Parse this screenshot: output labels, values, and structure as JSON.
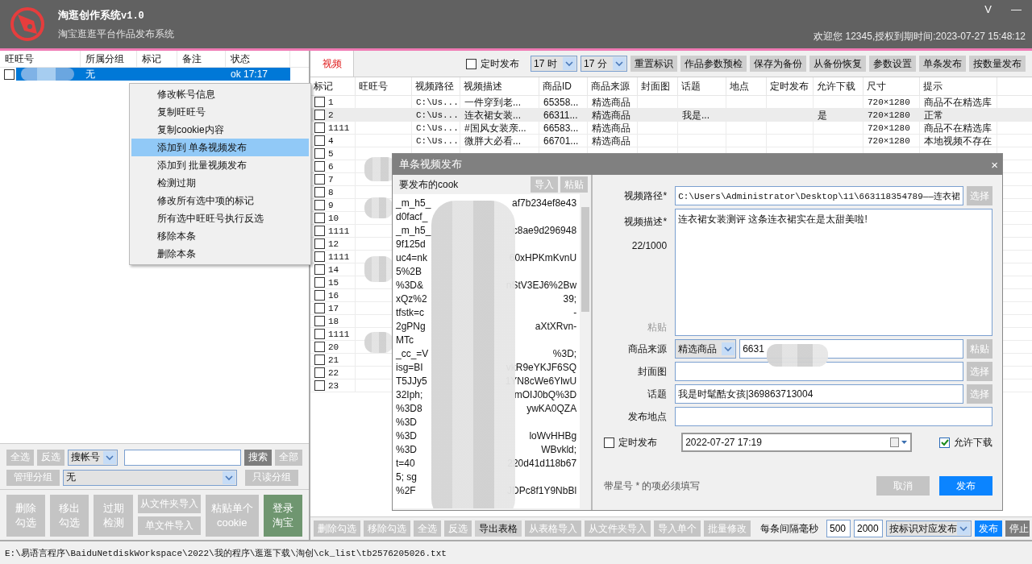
{
  "header": {
    "title": "淘逛创作系统",
    "version": "v1.0",
    "subtitle": "淘宝逛逛平台作品发布系统",
    "window_controls": [
      "V",
      "—"
    ],
    "welcome": "欢迎您 12345,授权到期时间:2023-07-27 15:48:12"
  },
  "accounts": {
    "columns": [
      "旺旺号",
      "所属分组",
      "标记",
      "备注",
      "状态"
    ],
    "rows": [
      {
        "checked": false,
        "selected": true,
        "group": "无",
        "status": "ok 17:17"
      }
    ]
  },
  "context_menu": [
    {
      "label": "修改帐号信息",
      "selected": false
    },
    {
      "label": "复制旺旺号",
      "selected": false
    },
    {
      "label": "复制cookie内容",
      "selected": false
    },
    {
      "label": "添加到 单条视频发布",
      "selected": true
    },
    {
      "label": "添加到 批量视频发布",
      "selected": false
    },
    {
      "label": "检测过期",
      "selected": false
    },
    {
      "label": "修改所有选中项的标记",
      "selected": false
    },
    {
      "label": "所有选中旺旺号执行反选",
      "selected": false
    },
    {
      "label": "移除本条",
      "selected": false
    },
    {
      "label": "删除本条",
      "selected": false
    }
  ],
  "account_controls": {
    "select_all": {
      "label": "全选",
      "kind": "disabled"
    },
    "invert": {
      "label": "反选",
      "kind": "disabled"
    },
    "search_type": "搜帐号",
    "search": {
      "label": "搜索",
      "kind": "dark"
    },
    "all": {
      "label": "全部",
      "kind": "disabled"
    },
    "manage_groups": {
      "label": "管理分组",
      "kind": "disabled"
    },
    "group": "无",
    "readonly_group": {
      "label": "只读分组",
      "kind": "disabled"
    },
    "actions": [
      {
        "label": "删除勾选",
        "kind": "disabled"
      },
      {
        "label": "移出勾选",
        "kind": "disabled"
      },
      {
        "label": "过期检测",
        "kind": "disabled"
      }
    ],
    "import_folder": {
      "label": "从文件夹导入",
      "kind": "disabled"
    },
    "import_file": {
      "label": "单文件导入",
      "kind": "disabled"
    },
    "paste_cookie": {
      "label": "粘贴单个cookie",
      "kind": "disabled"
    },
    "login": {
      "label": "登录淘宝",
      "kind": "green"
    }
  },
  "status_bar": "E:\\易语言程序\\BaiduNetdiskWorkspace\\2022\\我的程序\\逛逛下载\\淘创\\ck_list\\tb2576205026.txt",
  "video_panel": {
    "tabs": [
      {
        "label": "视频",
        "selected": true
      }
    ],
    "toolbar": {
      "schedule": {
        "label": "定时发布",
        "checked": false
      },
      "hour": "17 时",
      "minute": "17 分",
      "buttons": [
        {
          "label": "重置标识",
          "kind": "plain"
        },
        {
          "label": "作品参数预检",
          "kind": "plain"
        },
        {
          "label": "保存为备份",
          "kind": "plain"
        },
        {
          "label": "从备份恢复",
          "kind": "plain"
        },
        {
          "label": "参数设置",
          "kind": "plain"
        },
        {
          "label": "单条发布",
          "kind": "plain"
        },
        {
          "label": "按数量发布",
          "kind": "plain"
        }
      ]
    },
    "table": {
      "columns": [
        "标记",
        "旺旺号",
        "视频路径",
        "视频描述",
        "商品ID",
        "商品来源",
        "封面图",
        "话题",
        "地点",
        "定时发布",
        "允许下载",
        "尺寸",
        "提示"
      ],
      "rows": [
        {
          "checked": false,
          "selected": false,
          "mark": "1",
          "path": "C:\\Us...",
          "description": "一件穿到老...",
          "product_id": "65358...",
          "source": "精选商品",
          "size": "720×1280",
          "hint": "商品不在精选库"
        },
        {
          "checked": false,
          "selected": true,
          "mark": "2",
          "path": "C:\\Us...",
          "description": "连衣裙女装...",
          "product_id": "66311...",
          "source": "精选商品",
          "topic": "我是...",
          "allow_download": "是",
          "size": "720×1280",
          "hint": "正常"
        },
        {
          "checked": false,
          "selected": false,
          "mark": "1111",
          "path": "C:\\Us...",
          "description": "#国风女装亲...",
          "product_id": "66583...",
          "source": "精选商品",
          "size": "720×1280",
          "hint": "商品不在精选库"
        },
        {
          "checked": false,
          "selected": false,
          "mark": "4",
          "path": "C:\\Us...",
          "description": "微胖大必看...",
          "product_id": "66701...",
          "source": "精选商品",
          "size": "720×1280",
          "hint": "本地视频不存在"
        },
        {
          "checked": false,
          "selected": false,
          "mark": "5"
        },
        {
          "checked": false,
          "selected": false,
          "mark": "6"
        },
        {
          "checked": false,
          "selected": false,
          "mark": "7"
        },
        {
          "checked": false,
          "selected": false,
          "mark": "8"
        },
        {
          "checked": false,
          "selected": false,
          "mark": "9"
        },
        {
          "checked": false,
          "selected": false,
          "mark": "10"
        },
        {
          "checked": false,
          "selected": false,
          "mark": "1111"
        },
        {
          "checked": false,
          "selected": false,
          "mark": "12"
        },
        {
          "checked": false,
          "selected": false,
          "mark": "1111"
        },
        {
          "checked": false,
          "selected": false,
          "mark": "14"
        },
        {
          "checked": false,
          "selected": false,
          "mark": "15"
        },
        {
          "checked": false,
          "selected": false,
          "mark": "16"
        },
        {
          "checked": false,
          "selected": false,
          "mark": "17"
        },
        {
          "checked": false,
          "selected": false,
          "mark": "18"
        },
        {
          "checked": false,
          "selected": false,
          "mark": "1111"
        },
        {
          "checked": false,
          "selected": false,
          "mark": "20"
        },
        {
          "checked": false,
          "selected": false,
          "mark": "21"
        },
        {
          "checked": false,
          "selected": false,
          "mark": "22"
        },
        {
          "checked": false,
          "selected": false,
          "mark": "23"
        }
      ]
    },
    "bottom_bar": {
      "buttons": [
        {
          "label": "删除勾选",
          "kind": "disabled"
        },
        {
          "label": "移除勾选",
          "kind": "disabled"
        },
        {
          "label": "全选",
          "kind": "disabled"
        },
        {
          "label": "反选",
          "kind": "disabled"
        },
        {
          "label": "导出表格",
          "kind": "plain"
        },
        {
          "label": "从表格导入",
          "kind": "disabled"
        },
        {
          "label": "从文件夹导入",
          "kind": "disabled"
        },
        {
          "label": "导入单个",
          "kind": "disabled"
        },
        {
          "label": "批量修改",
          "kind": "disabled"
        }
      ],
      "interval_label": "每条间隔毫秒",
      "interval_min": "500",
      "interval_max": "2000",
      "mode": "按标识对应发布",
      "publish": {
        "label": "发布",
        "kind": "primary"
      },
      "stop": {
        "label": "停止",
        "kind": "dark"
      }
    }
  },
  "dialog": {
    "title": "单条视频发布",
    "close": "×",
    "cookie_label": "要发布的cook",
    "import": {
      "label": "导入",
      "kind": "disabled"
    },
    "paste": {
      "label": "粘贴",
      "kind": "disabled"
    },
    "cookie_lines": [
      {
        "start": "_m_h5_",
        "end": "af7b234ef8e43"
      },
      {
        "start": "d0facf_"
      },
      {
        "start": "_m_h5_",
        "end": "c8ae9d296948"
      },
      {
        "start": "9f125d"
      },
      {
        "start": "uc4=nk",
        "end": "60xHPKmKvnU"
      },
      {
        "start": "5%2B"
      },
      {
        "start": "%3D&",
        "end": "nStV3EJ6%2Bw"
      },
      {
        "start": "xQz%2",
        "end": "39;"
      },
      {
        "start": "tfstk=c",
        "end": "-"
      },
      {
        "start": "2gPNg",
        "end": "aXtXRvn-"
      },
      {
        "start": "MTc"
      },
      {
        "start": "_cc_=V",
        "end": "%3D;"
      },
      {
        "start": "isg=BI",
        "end": "vkR9eYKJF6SQ"
      },
      {
        "start": "T5JJy5",
        "end": "1YN8cWe6YlwU"
      },
      {
        "start": "32Iph;",
        "end": "mOIJ0bQ%3D"
      },
      {
        "start": "%3D8",
        "end": "ywKA0QZA"
      },
      {
        "start": "%3D"
      },
      {
        "start": "%3D",
        "end": "loWvHHBg"
      },
      {
        "start": "%3D",
        "end": "WBvkld;"
      },
      {
        "start": "t=40",
        "end": "220d41d118b67"
      },
      {
        "start": "5; sg"
      },
      {
        "start": "%2F",
        "end": "JDPc8f1Y9NbBl"
      }
    ],
    "form": {
      "path": {
        "label": "视频路径*",
        "value": "C:\\Users\\Administrator\\Desktop\\11\\663118354789——连衣裙",
        "button": {
          "label": "选择",
          "kind": "disabled"
        }
      },
      "description": {
        "label": "视频描述*",
        "counter": "22/1000",
        "paste": "粘贴",
        "value": "连衣裙女装测评  这条连衣裙实在是太甜美啦!"
      },
      "source": {
        "label": "商品来源",
        "option": "精选商品",
        "value": "6631",
        "button": {
          "label": "粘贴",
          "kind": "disabled"
        }
      },
      "cover": {
        "label": "封面图",
        "button": {
          "label": "选择",
          "kind": "disabled"
        }
      },
      "topic": {
        "label": "话题",
        "value": "我是时髦酷女孩|369863713004",
        "button": {
          "label": "选择",
          "kind": "disabled"
        }
      },
      "location": {
        "label": "发布地点"
      },
      "schedule": {
        "label": "定时发布",
        "checked": false,
        "datetime": "2022-07-27 17:19"
      },
      "allow_download": {
        "label": "允许下载",
        "checked": true
      },
      "hint": "带星号 * 的项必须填写",
      "cancel": {
        "label": "取消",
        "kind": "disabled"
      },
      "publish": {
        "label": "发布",
        "kind": "primary"
      }
    }
  }
}
